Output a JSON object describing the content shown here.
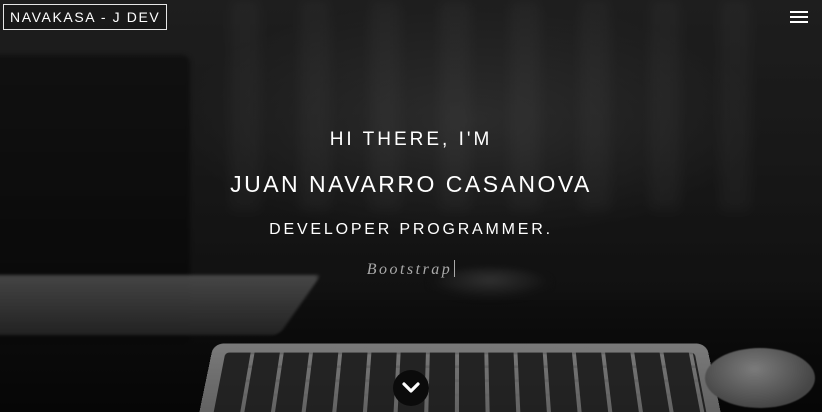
{
  "navbar": {
    "brand": "NAVAKASA - J DEV",
    "menu_icon": "hamburger-menu-icon"
  },
  "hero": {
    "greeting": "HI THERE, I'M",
    "name": "JUAN NAVARRO CASANOVA",
    "role": "DEVELOPER PROGRAMMER.",
    "typed_text": "Bootstrap",
    "scroll_icon": "chevron-down-icon"
  },
  "colors": {
    "text": "#ffffff",
    "typed_text": "#a9a9a9",
    "overlay": "#000000"
  }
}
